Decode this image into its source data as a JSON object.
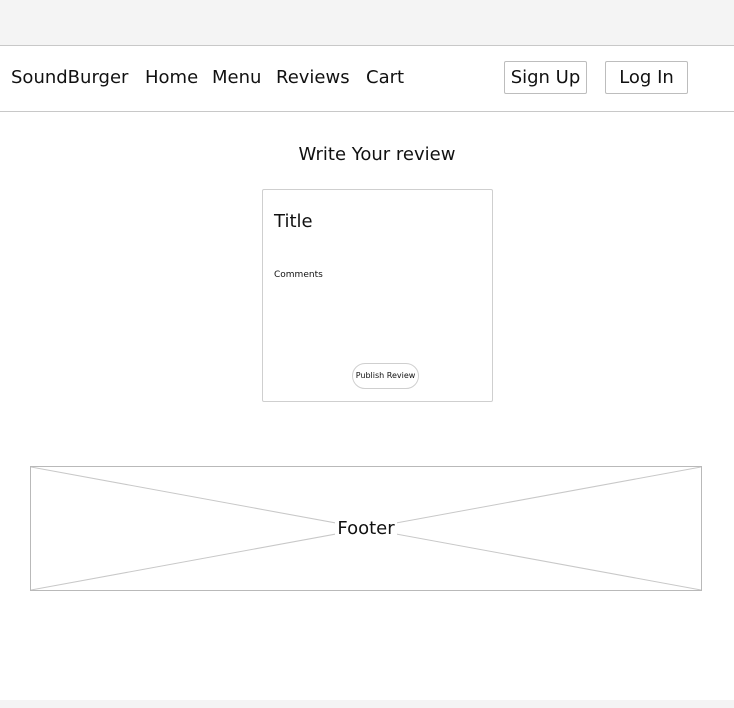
{
  "nav": {
    "brand": "SoundBurger",
    "links": [
      "Home",
      "Menu",
      "Reviews",
      "Cart"
    ],
    "signup_label": "Sign Up",
    "login_label": "Log In"
  },
  "main": {
    "heading": "Write Your review",
    "form": {
      "title_label": "Title",
      "comments_label": "Comments",
      "publish_label": "Publish Review"
    }
  },
  "footer": {
    "label": "Footer"
  }
}
